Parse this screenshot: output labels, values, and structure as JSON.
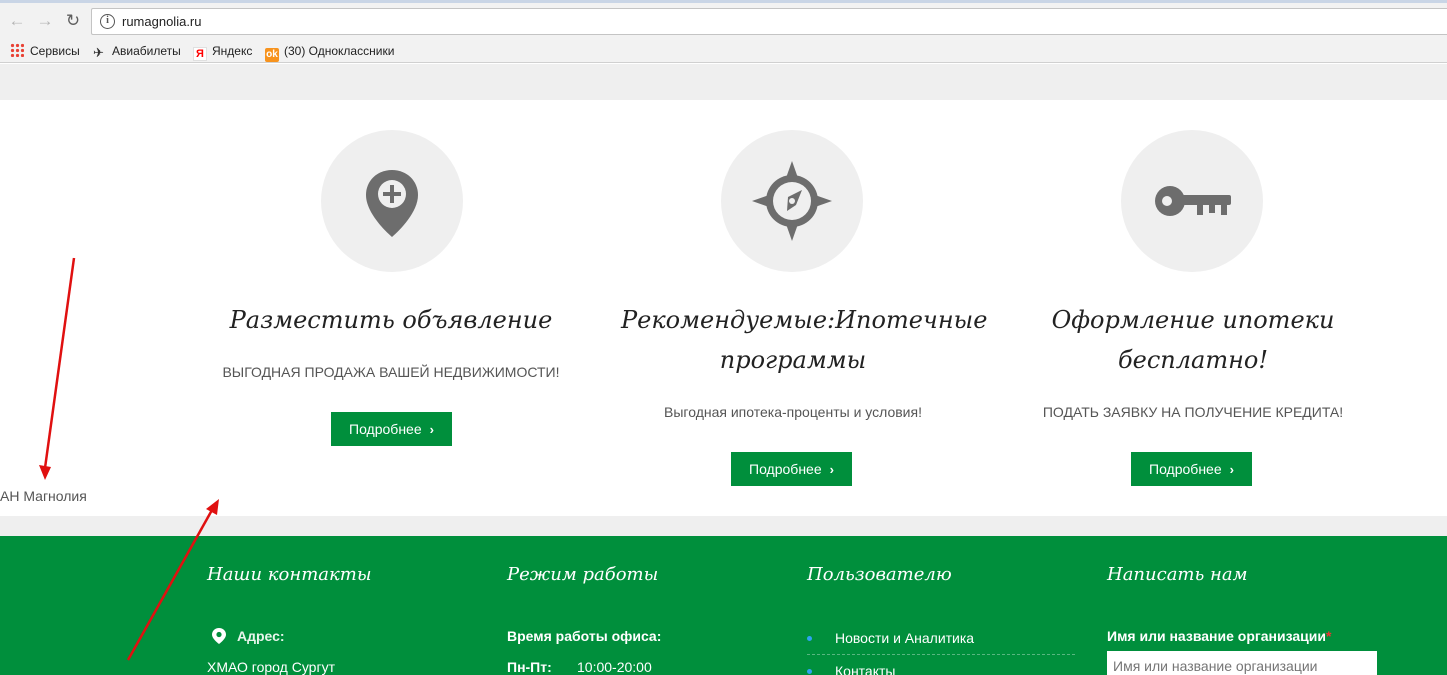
{
  "browser": {
    "url": "rumagnolia.ru",
    "bookmarks": [
      {
        "label": "Сервисы",
        "icon": "apps-grid-icon"
      },
      {
        "label": "Авиабилеты",
        "icon": "plane-icon"
      },
      {
        "label": "Яндекс",
        "icon": "yandex-icon"
      },
      {
        "label": "(30) Одноклассники",
        "icon": "odnoklassniki-icon"
      }
    ]
  },
  "features": [
    {
      "icon": "map-pin-plus-icon",
      "title": "Разместить объявление",
      "subtitle": "ВЫГОДНАЯ ПРОДАЖА ВАШЕЙ НЕДВИЖИМОСТИ!",
      "button": "Подробнее"
    },
    {
      "icon": "compass-icon",
      "title_line1": "Рекомендуемые:Ипотечные",
      "title_line2": "программы",
      "subtitle": "Выгодная ипотека-проценты и условия!",
      "button": "Подробнее"
    },
    {
      "icon": "key-icon",
      "title_line1": "Оформление ипотеки",
      "title_line2": "бесплатно!",
      "subtitle": "ПОДАТЬ ЗАЯВКУ НА ПОЛУЧЕНИЕ КРЕДИТА!",
      "button": "Подробнее"
    }
  ],
  "brand_text": "АН Магнолия",
  "footer": {
    "contacts": {
      "title": "Наши контакты",
      "address_label": "Адрес:",
      "address_value": "ХМАО город Сургут"
    },
    "hours": {
      "title": "Режим работы",
      "office_label": "Время работы офиса:",
      "days": "Пн-Пт:",
      "time": "10:00-20:00"
    },
    "users": {
      "title": "Пользователю",
      "links": [
        "Новости и Аналитика",
        "Контакты"
      ]
    },
    "write": {
      "title": "Написать нам",
      "field_label": "Имя или название организации",
      "required_mark": "*",
      "field_placeholder": "Имя или название организации"
    }
  },
  "colors": {
    "accent_green": "#008f3c",
    "arrow_red": "#e01010",
    "circle_gray": "#efefef"
  }
}
